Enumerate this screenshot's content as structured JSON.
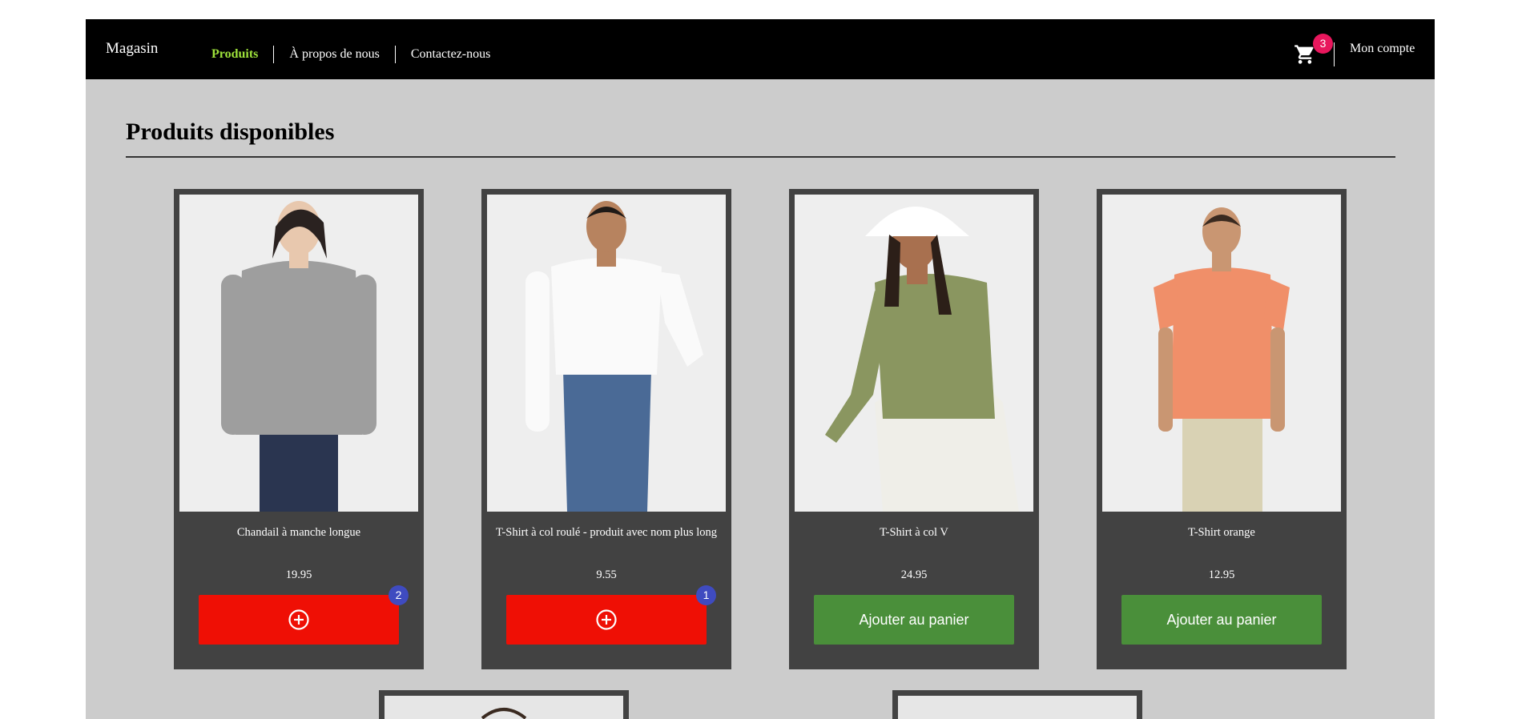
{
  "navbar": {
    "brand": "Magasin",
    "links": [
      {
        "label": "Produits",
        "active": true
      },
      {
        "label": "À propos de nous",
        "active": false
      },
      {
        "label": "Contactez-nous",
        "active": false
      }
    ],
    "cart_icon": "shopping-cart-icon",
    "cart_count": "3",
    "account_label": "Mon compte"
  },
  "main": {
    "title": "Produits disponibles",
    "products": [
      {
        "name": "Chandail à manche longue",
        "price": "19.95",
        "in_cart": true,
        "quantity": "2",
        "shirt_color": "#9e9e9e",
        "pants_color": "#2a3550"
      },
      {
        "name": "T-Shirt à col roulé - produit avec nom plus long",
        "price": "9.55",
        "in_cart": true,
        "quantity": "1",
        "shirt_color": "#fafafa",
        "pants_color": "#4a6a96"
      },
      {
        "name": "T-Shirt à col V",
        "price": "24.95",
        "in_cart": false,
        "button_label": "Ajouter au panier",
        "shirt_color": "#8a9660",
        "pants_color": "#efeee8"
      },
      {
        "name": "T-Shirt orange",
        "price": "12.95",
        "in_cart": false,
        "button_label": "Ajouter au panier",
        "shirt_color": "#f08f69",
        "pants_color": "#d9d2b4"
      }
    ]
  },
  "colors": {
    "navbar_bg": "#000000",
    "active_link": "#9ee23b",
    "page_bg": "#cccccc",
    "card_bg": "#424242",
    "add_button": "#4a8f3a",
    "quantity_button": "#ef0f05",
    "cart_badge": "#e8175d",
    "quantity_badge": "#3f4bc0"
  }
}
